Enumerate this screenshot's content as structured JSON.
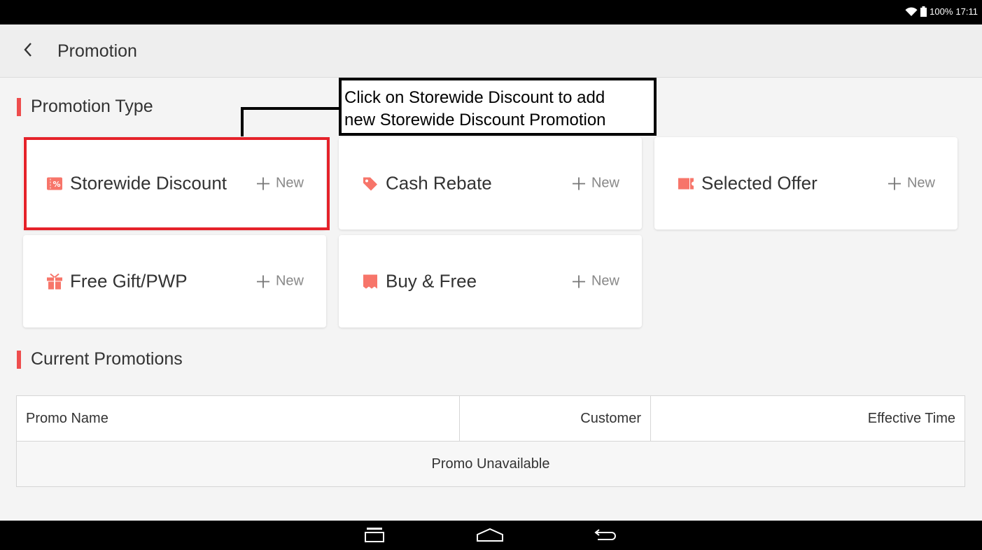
{
  "status_bar": {
    "battery": "100%",
    "time": "17:11",
    "icons": [
      "wifi-icon",
      "battery-icon"
    ]
  },
  "app_bar": {
    "title": "Promotion",
    "back_icon": "chevron-left-icon"
  },
  "sections": {
    "promotion_type": "Promotion Type",
    "current_promotions": "Current Promotions"
  },
  "promotion_types": [
    {
      "label": "Storewide Discount",
      "new_label": "New",
      "icon": "percent-ticket-icon"
    },
    {
      "label": "Cash Rebate",
      "new_label": "New",
      "icon": "tag-icon"
    },
    {
      "label": "Selected Offer",
      "new_label": "New",
      "icon": "coupon-icon"
    },
    {
      "label": "Free Gift/PWP",
      "new_label": "New",
      "icon": "gift-icon"
    },
    {
      "label": "Buy & Free",
      "new_label": "New",
      "icon": "receipt-icon"
    }
  ],
  "callout": {
    "line1": "Click on Storewide Discount to add",
    "line2": "new Storewide Discount Promotion"
  },
  "table": {
    "columns": [
      "Promo Name",
      "Customer",
      "Effective Time"
    ],
    "empty_text": "Promo Unavailable"
  },
  "colors": {
    "accent": "#ee4d4d",
    "icon_orange": "#f7756a",
    "highlight": "#e5222a"
  }
}
